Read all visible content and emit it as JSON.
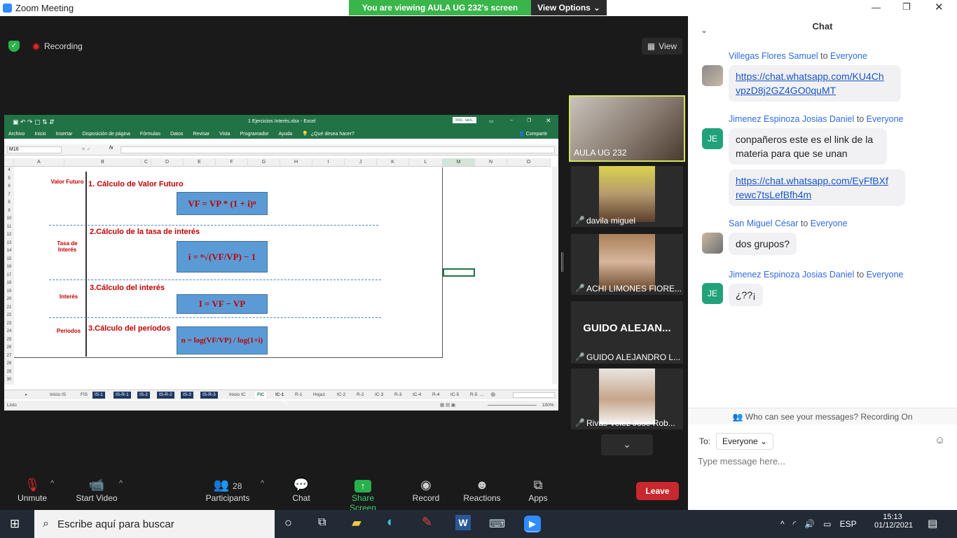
{
  "window": {
    "title": "Zoom Meeting"
  },
  "banner": {
    "viewing": "You are viewing AULA UG 232's screen",
    "view_options": "View Options"
  },
  "meeting": {
    "recording": "Recording",
    "view": "View"
  },
  "excel": {
    "title": "1 Ejercicios Interés.xlsx  -  Excel",
    "signin": "Inic. ses.",
    "ribbon": [
      "Archivo",
      "Inicio",
      "Insertar",
      "Disposición de página",
      "Fórmulas",
      "Datos",
      "Revisar",
      "Vista",
      "Programador",
      "Ayuda",
      "¿Qué desea hacer?"
    ],
    "share": "Compartir",
    "namebox": "M16",
    "fx": "fx",
    "columns": [
      "A",
      "B",
      "C",
      "D",
      "E",
      "F",
      "G",
      "H",
      "I",
      "J",
      "K",
      "L",
      "M",
      "N",
      "O"
    ],
    "rows": [
      "4",
      "5",
      "6",
      "7",
      "8",
      "9",
      "10",
      "11",
      "12",
      "13",
      "14",
      "15",
      "16",
      "17",
      "18",
      "19",
      "20",
      "21",
      "22",
      "23",
      "24",
      "25",
      "26",
      "27",
      "28",
      "29",
      "30"
    ],
    "sections": [
      {
        "label": "Valor Futuro",
        "title": "1. Cálculo de Valor Futuro",
        "formula": "VF = VP * (1 + i)ⁿ"
      },
      {
        "label": "Tasa de Interés",
        "title": "2.Cálculo de la tasa de interés",
        "formula": "i = ⁿ√(VF/VP) − 1"
      },
      {
        "label": "Interés",
        "title": "3.Cálculo del interés",
        "formula": "I = VF − VP"
      },
      {
        "label": "Períodos",
        "title": "3.Cálculo del períodos",
        "formula": "n = log(VF/VP) / log(1+i)"
      }
    ],
    "tabs": [
      "Inicio IS",
      "FIS",
      "IS-1",
      "IS-R-1",
      "IS-2",
      "IS-R-2",
      "IS-3",
      "IS-R-3",
      "Inicio IC",
      "FIC",
      "IC-1",
      "R-1",
      "Hoja1",
      "IC-2",
      "R-2",
      "IC-3",
      "R-3",
      "IC-4",
      "R-4",
      "IC-5",
      "R-5",
      "..."
    ],
    "status": "Listo",
    "zoom": "100%"
  },
  "participants": [
    {
      "name": "AULA UG 232",
      "muted": false
    },
    {
      "name": "davila miguel",
      "muted": true
    },
    {
      "name": "ACHI LIMONES FIORE...",
      "muted": true
    },
    {
      "name": "GUIDO ALEJANDRO L...",
      "muted": true,
      "big_name": "GUIDO ALEJAN..."
    },
    {
      "name": "Rivas Velez Jose Rob...",
      "muted": true
    }
  ],
  "toolbar": {
    "unmute": "Unmute",
    "start_video": "Start Video",
    "participants": "Participants",
    "participants_count": "28",
    "chat": "Chat",
    "share": "Share Screen",
    "record": "Record",
    "reactions": "Reactions",
    "apps": "Apps",
    "leave": "Leave"
  },
  "chat": {
    "title": "Chat",
    "messages": [
      {
        "sender": "Villegas Flores Samuel",
        "to": "to",
        "target": "Everyone",
        "text": "https://chat.whatsapp.com/KU4Ch vpzD8j2GZ4GO0quMT",
        "line1": "https://chat.whatsapp.com/KU4Ch",
        "line2": "vpzD8j2GZ4GO0quMT"
      },
      {
        "sender": "Jimenez Espinoza Josias Daniel",
        "to": "to",
        "target": "Everyone",
        "line1": "conpañeros este es el link de la",
        "line2": "materia para que se unan",
        "initials": "JE"
      },
      {
        "line1": "https://chat.whatsapp.com/EyFfBXf",
        "line2": "rewc7tsLefBfh4m"
      },
      {
        "sender": "San Miguel César",
        "to": "to",
        "target": "Everyone",
        "line1": "dos grupos?"
      },
      {
        "sender": "Jimenez Espinoza Josias Daniel",
        "to": "to",
        "target": "Everyone",
        "line1": "¿??¡",
        "initials": "JE"
      }
    ],
    "privacy": "Who can see your messages? Recording On",
    "to_label": "To:",
    "to_value": "Everyone",
    "placeholder": "Type message here..."
  },
  "taskbar": {
    "search": "Escribe aquí para buscar",
    "lang": "ESP",
    "time": "15:13",
    "date": "01/12/2021"
  }
}
